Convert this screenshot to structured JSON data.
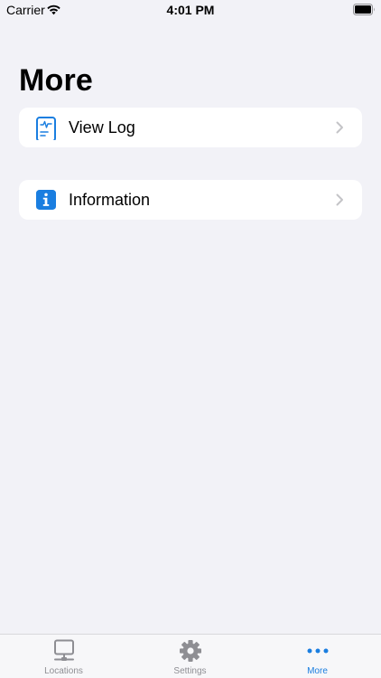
{
  "status_bar": {
    "carrier": "Carrier",
    "time": "4:01 PM"
  },
  "page": {
    "title": "More"
  },
  "menu": {
    "items": [
      {
        "label": "View Log",
        "icon": "log-document-icon"
      },
      {
        "label": "Information",
        "icon": "info-icon"
      }
    ]
  },
  "tab_bar": {
    "tabs": [
      {
        "label": "Locations",
        "icon": "monitor-icon",
        "active": false
      },
      {
        "label": "Settings",
        "icon": "gear-icon",
        "active": false
      },
      {
        "label": "More",
        "icon": "ellipsis-icon",
        "active": true
      }
    ]
  },
  "colors": {
    "accent": "#1a7ee0",
    "background": "#f2f2f7",
    "inactive_tab": "#8e8e93",
    "card": "#ffffff"
  }
}
